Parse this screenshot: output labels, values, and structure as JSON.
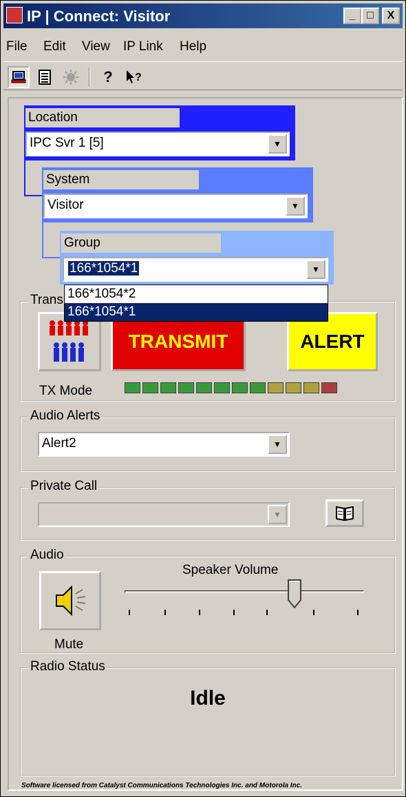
{
  "window": {
    "title": "IP | Connect: Visitor",
    "minimize": "_",
    "maximize": "□",
    "close": "X"
  },
  "menu": [
    "File",
    "Edit",
    "View",
    "IP Link",
    "Help"
  ],
  "toolbar": {
    "icons": [
      "computer-icon",
      "list-icon",
      "sun-icon",
      "help-icon",
      "context-help-icon"
    ],
    "help_glyph": "?",
    "context_help_glyph": "?"
  },
  "location": {
    "label": "Location",
    "value": "IPC Svr 1 [5]"
  },
  "system": {
    "label": "System",
    "value": "Visitor"
  },
  "group": {
    "label": "Group",
    "value": "166*1054*1",
    "options": [
      "166*1054*2",
      "166*1054*1"
    ],
    "selected_index": 1
  },
  "transmit": {
    "legend": "Trans",
    "tx_mode_label": "TX Mode",
    "transmit_label": "TRANSMIT",
    "alert_label": "ALERT",
    "meter_colors": [
      "#3a9a3a",
      "#3a9a3a",
      "#3a9a3a",
      "#3a9a3a",
      "#3a9a3a",
      "#3a9a3a",
      "#3a9a3a",
      "#3a9a3a",
      "#b0a040",
      "#b0a040",
      "#b0a040",
      "#a84040"
    ]
  },
  "audio_alerts": {
    "legend": "Audio Alerts",
    "value": "Alert2"
  },
  "private_call": {
    "legend": "Private Call",
    "value": ""
  },
  "audio": {
    "legend": "Audio",
    "volume_label": "Speaker Volume",
    "volume_level": 0.71,
    "mute_label": "Mute"
  },
  "radio_status": {
    "legend": "Radio Status",
    "value": "Idle"
  },
  "footer": "Software licensed from Catalyst Communications Technologies Inc. and Motorola Inc.",
  "colors": {
    "titlebar": "#0a246a",
    "transmit_bg": "#e00000",
    "transmit_text": "#ffff00",
    "alert_bg": "#ffff00",
    "location_panel": "#2020ff",
    "system_panel": "#5a7cff",
    "group_panel": "#8cb4ff"
  }
}
